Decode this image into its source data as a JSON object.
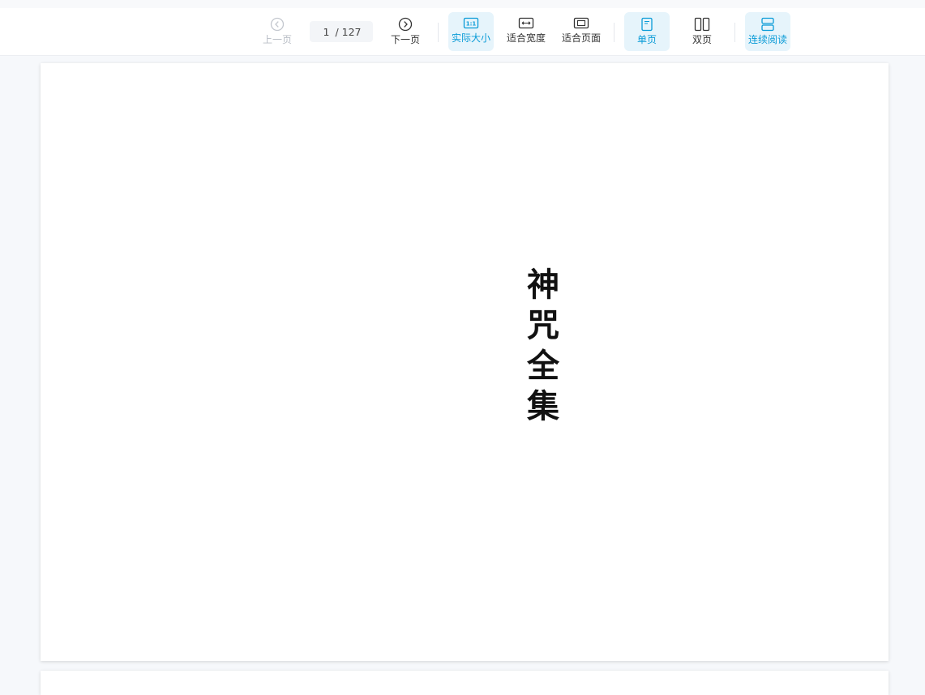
{
  "toolbar": {
    "prev_label": "上一页",
    "next_label": "下一页",
    "current_page": "1",
    "total_pages": "/ 127",
    "actual_size_label": "实际大小",
    "fit_width_label": "适合宽度",
    "fit_page_label": "适合页面",
    "single_page_label": "单页",
    "double_page_label": "双页",
    "continuous_label": "连续阅读",
    "accent_color": "#0a9bd7"
  },
  "document": {
    "title": "神咒全集"
  }
}
